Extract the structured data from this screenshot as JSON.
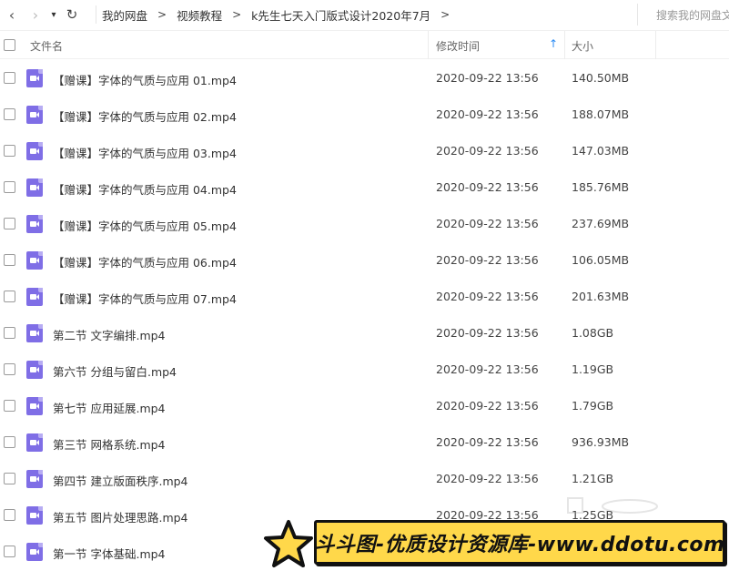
{
  "nav": {
    "back_glyph": "‹",
    "forward_glyph": "›",
    "dropdown_glyph": "▾",
    "refresh_glyph": "↻",
    "breadcrumbs": [
      "我的网盘",
      "视频教程",
      "k先生七天入门版式设计2020年7月"
    ],
    "separator": ">",
    "search_placeholder": "搜索我的网盘文件"
  },
  "header": {
    "name": "文件名",
    "time": "修改时间",
    "sort_glyph": "↑",
    "size": "大小"
  },
  "files": [
    {
      "name": "【赠课】字体的气质与应用 01.mp4",
      "time": "2020-09-22 13:56",
      "size": "140.50MB",
      "icon": "video-file-icon"
    },
    {
      "name": "【赠课】字体的气质与应用 02.mp4",
      "time": "2020-09-22 13:56",
      "size": "188.07MB",
      "icon": "video-file-icon"
    },
    {
      "name": "【赠课】字体的气质与应用 03.mp4",
      "time": "2020-09-22 13:56",
      "size": "147.03MB",
      "icon": "video-file-icon"
    },
    {
      "name": "【赠课】字体的气质与应用 04.mp4",
      "time": "2020-09-22 13:56",
      "size": "185.76MB",
      "icon": "video-file-icon"
    },
    {
      "name": "【赠课】字体的气质与应用 05.mp4",
      "time": "2020-09-22 13:56",
      "size": "237.69MB",
      "icon": "video-file-icon"
    },
    {
      "name": "【赠课】字体的气质与应用 06.mp4",
      "time": "2020-09-22 13:56",
      "size": "106.05MB",
      "icon": "video-file-icon"
    },
    {
      "name": "【赠课】字体的气质与应用 07.mp4",
      "time": "2020-09-22 13:56",
      "size": "201.63MB",
      "icon": "video-file-icon"
    },
    {
      "name": "第二节 文字编排.mp4",
      "time": "2020-09-22 13:56",
      "size": "1.08GB",
      "icon": "video-file-icon"
    },
    {
      "name": "第六节 分组与留白.mp4",
      "time": "2020-09-22 13:56",
      "size": "1.19GB",
      "icon": "video-file-icon"
    },
    {
      "name": "第七节 应用延展.mp4",
      "time": "2020-09-22 13:56",
      "size": "1.79GB",
      "icon": "video-file-icon"
    },
    {
      "name": "第三节 网格系统.mp4",
      "time": "2020-09-22 13:56",
      "size": "936.93MB",
      "icon": "video-file-icon"
    },
    {
      "name": "第四节 建立版面秩序.mp4",
      "time": "2020-09-22 13:56",
      "size": "1.21GB",
      "icon": "video-file-icon"
    },
    {
      "name": "第五节 图片处理思路.mp4",
      "time": "2020-09-22 13:56",
      "size": "1.25GB",
      "icon": "video-file-icon"
    },
    {
      "name": "第一节 字体基础.mp4",
      "time": "",
      "size": "",
      "icon": "video-file-icon"
    }
  ],
  "watermark": {
    "text": "斗斗图-优质设计资源库-www.ddotu.com"
  },
  "colors": {
    "accent": "#2b8cf4",
    "video_icon": "#7f6ee6",
    "watermark_bg": "#ffd84a"
  }
}
